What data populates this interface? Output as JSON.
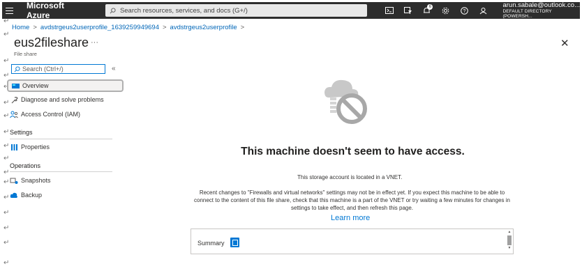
{
  "topbar": {
    "brand": "Microsoft Azure",
    "search_placeholder": "Search resources, services, and docs (G+/)",
    "notification_count": "6",
    "account_email": "arun.sabale@outlook.co...",
    "account_directory": "DEFAULT DIRECTORY (POWERSH..."
  },
  "breadcrumb": {
    "items": [
      "Home",
      "avdstrgeus2userprofile_1639259949694",
      "avdstrgeus2userprofile"
    ],
    "separator": ">"
  },
  "header": {
    "title": "eus2fileshare",
    "more": "···",
    "subtitle": "File share",
    "close": "✕"
  },
  "sidebar": {
    "search_placeholder": "Search (Ctrl+/)",
    "collapse": "«",
    "items": [
      {
        "label": "Overview",
        "icon": "overview-icon"
      },
      {
        "label": "Diagnose and solve problems",
        "icon": "wrench-icon"
      },
      {
        "label": "Access Control (IAM)",
        "icon": "people-icon"
      },
      {
        "label": "Properties",
        "icon": "properties-icon"
      },
      {
        "label": "Snapshots",
        "icon": "snapshot-icon"
      },
      {
        "label": "Backup",
        "icon": "backup-cloud-icon"
      }
    ],
    "sections": [
      "Settings",
      "Operations"
    ]
  },
  "main": {
    "headline": "This machine doesn't seem to have access.",
    "vnet_notice": "This storage account is located in a VNET.",
    "paragraph": "Recent changes to \"Firewalls and virtual networks\" settings may not be in effect yet. If you expect this machine to be able to connect to the content of this file share, check that this machine is a part of the VNET or try waiting a few minutes for changes in settings to take effect, and then refresh this page.",
    "learn_more": "Learn more",
    "summary_label": "Summary"
  },
  "colors": {
    "topbar_bg": "#2d2d2d",
    "accent": "#0078d4",
    "link": "#0066b8"
  },
  "return_marks": "↵"
}
